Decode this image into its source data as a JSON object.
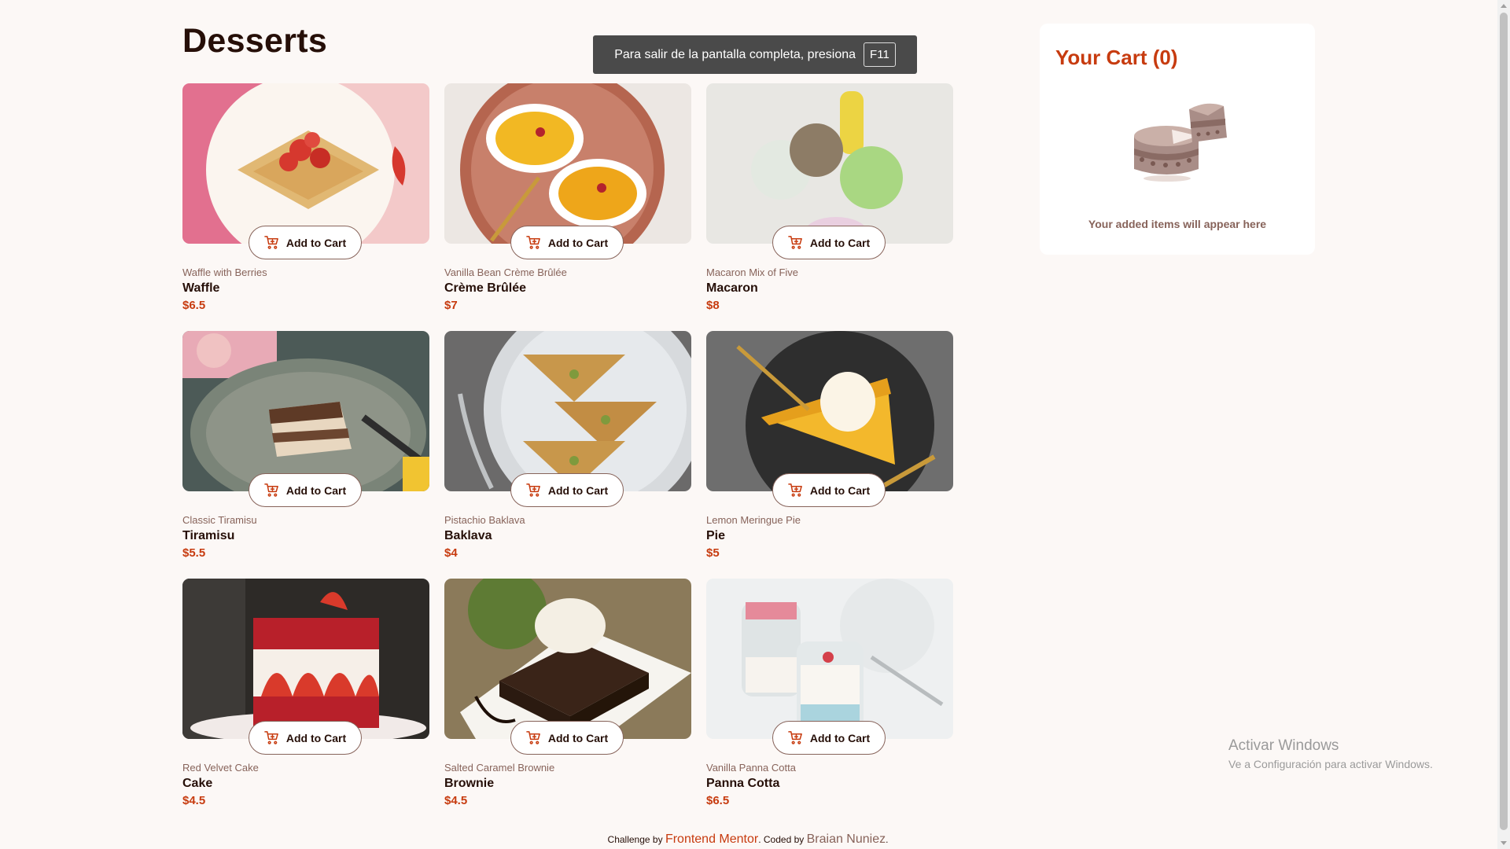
{
  "page": {
    "title": "Desserts"
  },
  "fullscreen_notice": {
    "text": "Para salir de la pantalla completa, presiona",
    "key": "F11"
  },
  "add_to_cart_label": "Add to Cart",
  "products": [
    {
      "category": "Waffle with Berries",
      "name": "Waffle",
      "price": "$6.5",
      "image": "waffle-photo"
    },
    {
      "category": "Vanilla Bean Crème Brûlée",
      "name": "Crème Brûlée",
      "price": "$7",
      "image": "creme-brulee-photo"
    },
    {
      "category": "Macaron Mix of Five",
      "name": "Macaron",
      "price": "$8",
      "image": "macaron-photo"
    },
    {
      "category": "Classic Tiramisu",
      "name": "Tiramisu",
      "price": "$5.5",
      "image": "tiramisu-photo"
    },
    {
      "category": "Pistachio Baklava",
      "name": "Baklava",
      "price": "$4",
      "image": "baklava-photo"
    },
    {
      "category": "Lemon Meringue Pie",
      "name": "Pie",
      "price": "$5",
      "image": "pie-photo"
    },
    {
      "category": "Red Velvet Cake",
      "name": "Cake",
      "price": "$4.5",
      "image": "cake-photo"
    },
    {
      "category": "Salted Caramel Brownie",
      "name": "Brownie",
      "price": "$4.5",
      "image": "brownie-photo"
    },
    {
      "category": "Vanilla Panna Cotta",
      "name": "Panna Cotta",
      "price": "$6.5",
      "image": "panna-cotta-photo"
    }
  ],
  "cart": {
    "title": "Your Cart (0)",
    "empty_text": "Your added items will appear here",
    "illustration": "empty-cart-cake-icon"
  },
  "windows_activation": {
    "title": "Activar Windows",
    "subtitle": "Ve a Configuración para activar Windows."
  },
  "footer": {
    "prefix": "Challenge by",
    "link": "Frontend Mentor",
    "middle": ". Coded by",
    "coder": "Braian Nuniez",
    "suffix": "."
  },
  "colors": {
    "background": "#fcf8f6",
    "accent": "#c73b0f",
    "text_dark": "#260f08",
    "text_muted": "#87635a"
  }
}
